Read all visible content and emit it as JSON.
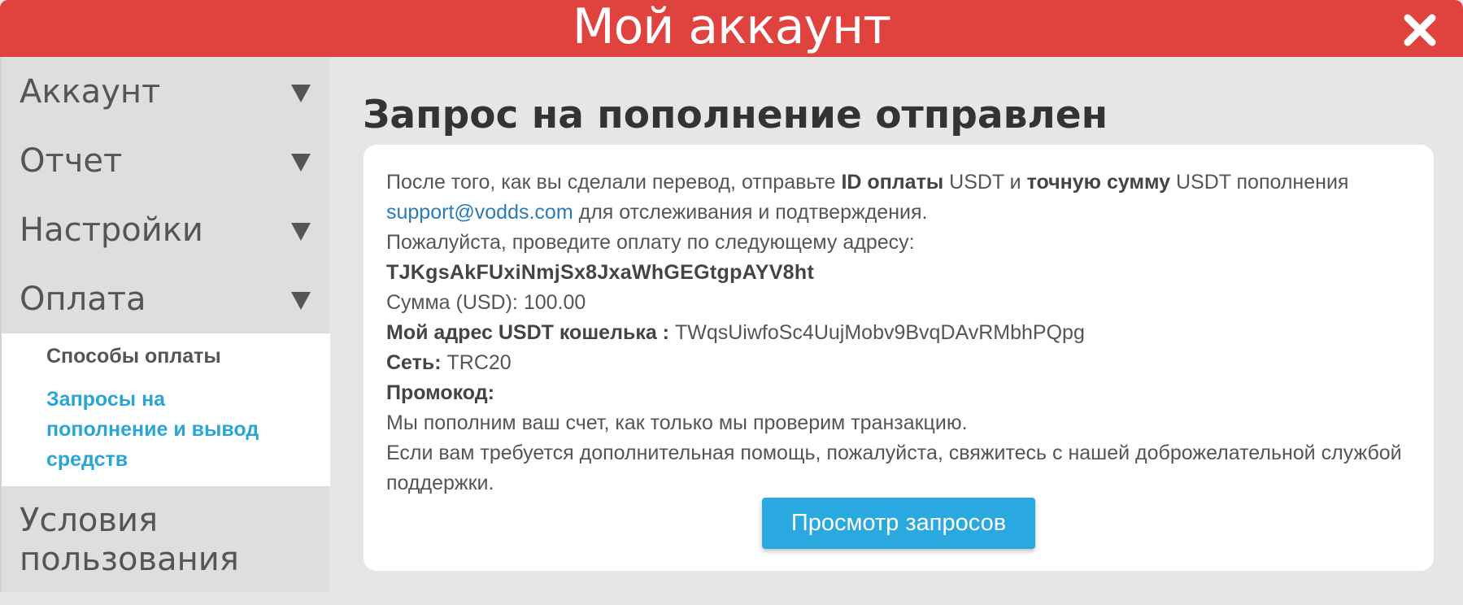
{
  "window": {
    "title": "Мой аккаунт"
  },
  "icons": {
    "close": "close-icon",
    "menu_arrow": "triangle-down-icon"
  },
  "colors": {
    "header": "#e0433e",
    "accent": "#2aa8e0",
    "link": "#2b7bb9",
    "active_sub": "#2aa5d8"
  },
  "sidebar": {
    "items": [
      {
        "label": "Аккаунт"
      },
      {
        "label": "Отчет"
      },
      {
        "label": "Настройки"
      },
      {
        "label": "Оплата"
      }
    ],
    "submenu": {
      "payment_methods": "Способы оплаты",
      "requests": "Запросы на пополнение и вывод средств"
    },
    "terms": {
      "line1": "Условия",
      "line2": "пользования"
    }
  },
  "main": {
    "heading": "Запрос на пополнение отправлен",
    "p1": {
      "a": "После того, как вы сделали перевод, отправьте ",
      "b": "ID оплаты",
      "c": " USDT и ",
      "d": "точную сумму",
      "e": " USDT пополнения ",
      "email": "support@vodds.com",
      "f": " для отслеживания и подтверждения."
    },
    "p2": "Пожалуйста, проведите оплату по следующему адресу:",
    "address": "TJKgsAkFUxiNmjSx8JxaWhGEGtgpAYV8ht",
    "amount": "Сумма (USD): 100.00",
    "wallet_label": "Мой адрес USDT кошелька :",
    "wallet_value": " TWqsUiwfoSc4UujMobv9BvqDAvRMbhPQpg",
    "network_label": "Сеть:",
    "network_value": " TRC20",
    "promo_label": "Промокод:",
    "p3": "Мы пополним ваш счет, как только мы проверим транзакцию.",
    "p4": "Если вам требуется дополнительная помощь, пожалуйста, свяжитесь с нашей доброжелательной службой поддержки.",
    "button": "Просмотр запросов"
  }
}
